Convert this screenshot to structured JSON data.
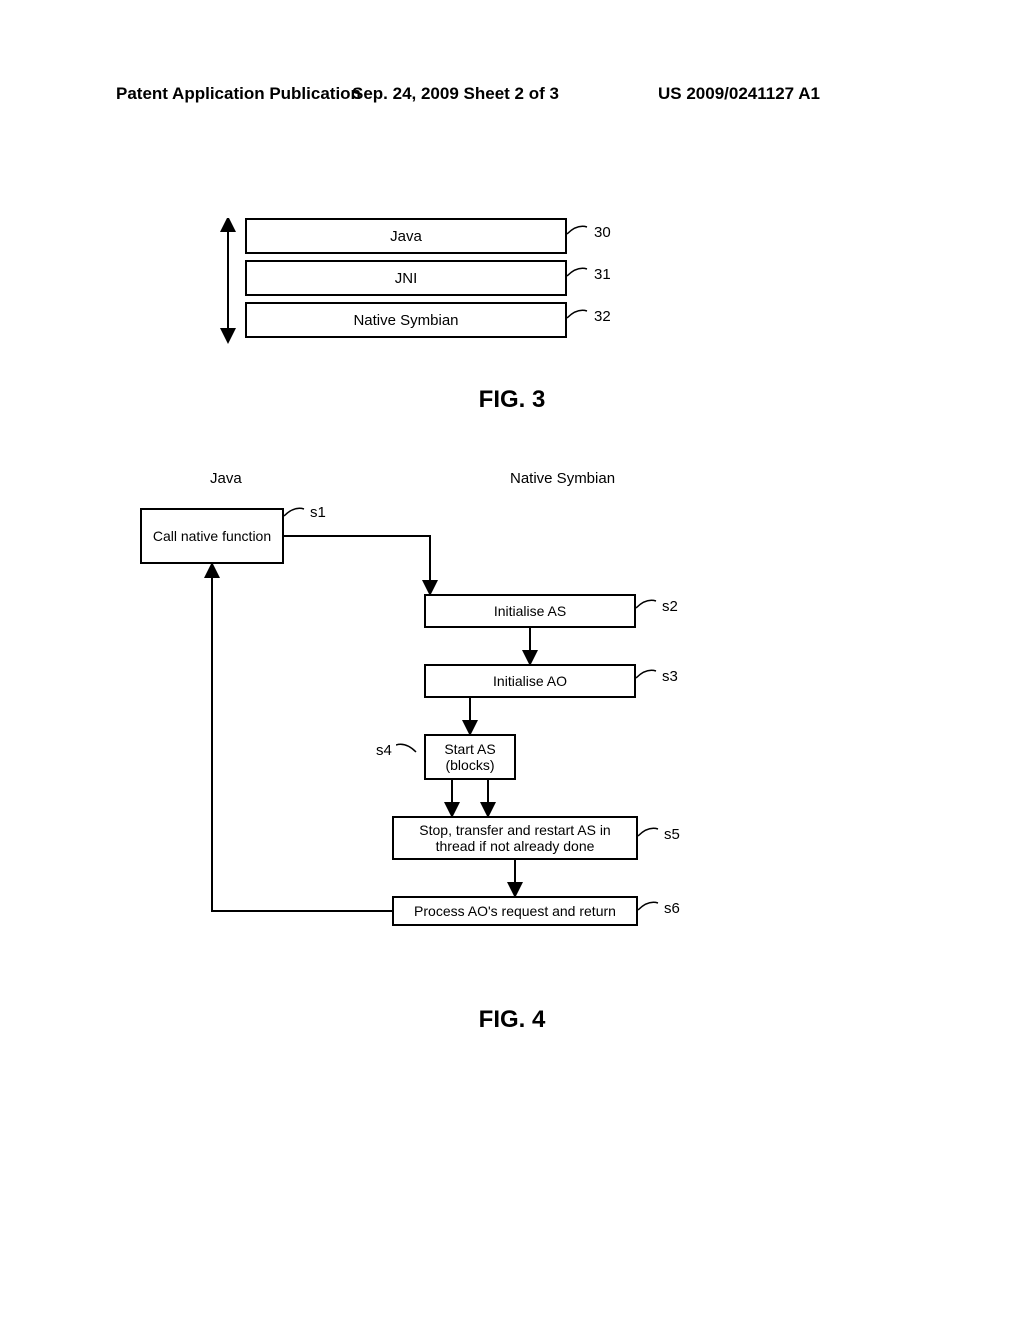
{
  "header": {
    "left": "Patent Application Publication",
    "center": "Sep. 24, 2009  Sheet 2 of 3",
    "right": "US 2009/0241127 A1"
  },
  "fig3": {
    "caption": "FIG. 3",
    "layers": [
      {
        "label": "Java",
        "ref": "30"
      },
      {
        "label": "JNI",
        "ref": "31"
      },
      {
        "label": "Native Symbian",
        "ref": "32"
      }
    ]
  },
  "fig4": {
    "caption": "FIG. 4",
    "columns": {
      "left": "Java",
      "right": "Native Symbian"
    },
    "steps": [
      {
        "id": "s1",
        "label": "Call native function"
      },
      {
        "id": "s2",
        "label": "Initialise AS"
      },
      {
        "id": "s3",
        "label": "Initialise AO"
      },
      {
        "id": "s4",
        "label": "Start AS (blocks)"
      },
      {
        "id": "s5",
        "label": "Stop, transfer and restart AS in thread if not already done"
      },
      {
        "id": "s6",
        "label": "Process AO's request and return"
      }
    ]
  }
}
